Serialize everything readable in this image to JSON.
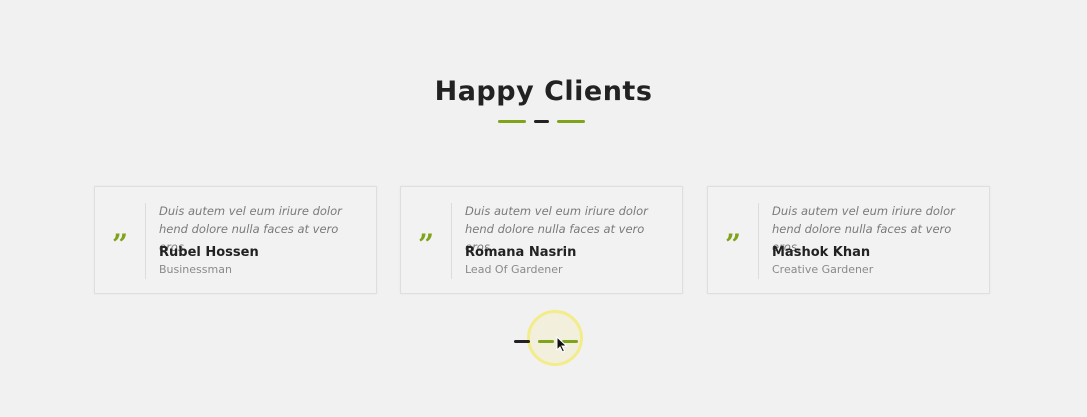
{
  "section": {
    "title": "Happy Clients"
  },
  "colors": {
    "accent": "#7fa41c",
    "dark": "#222222"
  },
  "testimonials": [
    {
      "text": "Duis autem vel eum iriure dolor hend dolore nulla faces at vero eros.",
      "name": "Rubel Hossen",
      "role": "Businessman"
    },
    {
      "text": "Duis autem vel eum iriure dolor hend dolore nulla faces at vero eros.",
      "name": "Romana Nasrin",
      "role": "Lead Of Gardener"
    },
    {
      "text": "Duis autem vel eum iriure dolor hend dolore nulla faces at vero eros.",
      "name": "Mashok Khan",
      "role": "Creative Gardener"
    }
  ],
  "quote_icon": {
    "glyph": "”",
    "name": "quote-icon"
  },
  "pager": {
    "count": 3,
    "active_index": 0
  }
}
